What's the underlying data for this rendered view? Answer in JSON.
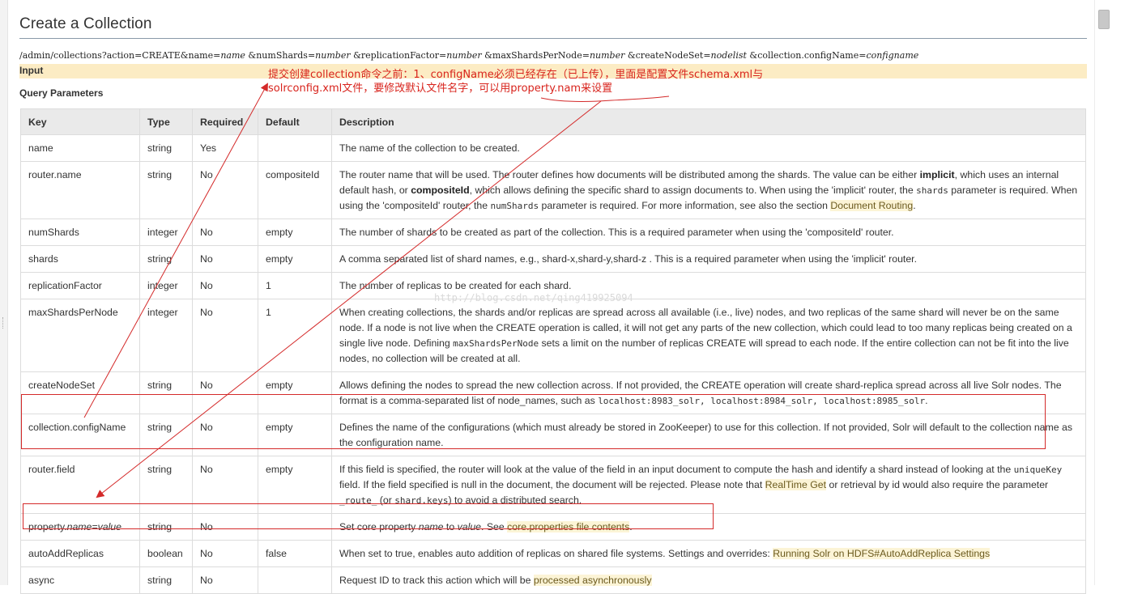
{
  "page": {
    "title": "Create a Collection"
  },
  "endpoint": {
    "prefix": "/admin/collections?action=CREATE&name=",
    "name_param": "name",
    "shards_prefix": " &numShards=",
    "shards_param": "number",
    "rf_prefix": " &replicationFactor=",
    "rf_param": "number",
    "maxspn_prefix": " &maxShardsPerNode=",
    "maxspn_param": "number",
    "cns_prefix": " &createNodeSet=",
    "cns_param": "nodelist",
    "cfg_prefix": " &collection.configName=",
    "cfg_param": "configname"
  },
  "sections": {
    "input": "Input",
    "query_params": "Query Parameters"
  },
  "table": {
    "headers": [
      "Key",
      "Type",
      "Required",
      "Default",
      "Description"
    ],
    "rows": [
      {
        "key": "name",
        "type": "string",
        "required": "Yes",
        "default": "",
        "desc": {
          "text": "The name of the collection to be created."
        }
      },
      {
        "key": "router.name",
        "type": "string",
        "required": "No",
        "default": "compositeId",
        "desc": {
          "p1": "The router name that will be used. The router defines how documents will be distributed among the shards. The value can be either ",
          "b1": "implicit",
          "p2": ", which uses an internal default hash, or ",
          "b2": "compositeId",
          "p3": ", which allows defining the specific shard to assign documents to. When using the 'implicit' router, the ",
          "m1": "shards",
          "p4": " parameter is required. When using the 'compositeId' router, the ",
          "m2": "numShards",
          "p5": " parameter is required. For more information, see also the section ",
          "link": "Document Routing",
          "p6": "."
        }
      },
      {
        "key": "numShards",
        "type": "integer",
        "required": "No",
        "default": "empty",
        "desc": {
          "text": "The number of shards to be created as part of the collection. This is a required parameter when using the 'compositeId' router."
        }
      },
      {
        "key": "shards",
        "type": "string",
        "required": "No",
        "default": "empty",
        "desc": {
          "text": "A comma separated list of shard names, e.g., shard-x,shard-y,shard-z . This is a required parameter when using the 'implicit' router."
        }
      },
      {
        "key": "replicationFactor",
        "type": "integer",
        "required": "No",
        "default": "1",
        "desc": {
          "text": "The number of replicas to be created for each shard."
        }
      },
      {
        "key": "maxShardsPerNode",
        "type": "integer",
        "required": "No",
        "default": "1",
        "desc": {
          "p1": "When creating collections, the shards and/or replicas are spread across all available (i.e., live) nodes, and two replicas of the same shard will never be on the same node. If a node is not live when the CREATE operation is called, it will not get any parts of the new collection, which could lead to too many replicas being created on a single live node. Defining ",
          "m1": "maxShardsPerNode",
          "p2": " sets a limit on the number of replicas CREATE will spread to each node. If the entire collection can not be fit into the live nodes, no collection will be created at all."
        }
      },
      {
        "key": "createNodeSet",
        "type": "string",
        "required": "No",
        "default": "empty",
        "desc": {
          "p1": "Allows defining the nodes to spread the new collection across. If not provided, the CREATE operation will create shard-replica spread across all live Solr nodes. The format is a comma-separated list of node_names, such as ",
          "m1": "localhost:8983_solr, localhost:8984_solr, localhost:8985_solr",
          "p2": "."
        }
      },
      {
        "key": "collection.configName",
        "type": "string",
        "required": "No",
        "default": "empty",
        "desc": {
          "text": "Defines the name of the configurations (which must already be stored in ZooKeeper) to use for this collection. If not provided, Solr will default to the collection name as the configuration name."
        }
      },
      {
        "key": "router.field",
        "type": "string",
        "required": "No",
        "default": "empty",
        "desc": {
          "p1": "If this field is specified, the router will look at the value of the field in an input document to compute the hash and identify a shard instead of looking at the ",
          "m1": "uniqueKey",
          "p2": " field. If the field specified is null in the document, the document will be rejected. Please note that ",
          "link": "RealTime Get",
          "p3": " or retrieval by id would also require the parameter ",
          "m2": "_route_",
          "p4": " (or ",
          "m3": "shard.keys",
          "p5": ") to avoid a distributed search."
        }
      },
      {
        "key_prefix": "property.",
        "key_italic": "name",
        "key_eq": "=",
        "key_italic2": "value",
        "type": "string",
        "required": "No",
        "default": "",
        "desc": {
          "p1": "Set core property ",
          "i1": "name",
          "p2": " to ",
          "i2": "value",
          "p3": ". See ",
          "link": "core.properties file contents",
          "p4": "."
        }
      },
      {
        "key": "autoAddReplicas",
        "type": "boolean",
        "required": "No",
        "default": "false",
        "desc": {
          "p1": "When set to true, enables auto addition of replicas on shared file systems. Settings and overrides: ",
          "link": "Running Solr on HDFS#AutoAddReplica Settings"
        }
      },
      {
        "key": "async",
        "type": "string",
        "required": "No",
        "default": "",
        "desc": {
          "p1": "Request ID to track this action which will be ",
          "link": "processed asynchronously"
        }
      }
    ]
  },
  "annotation": {
    "line1": "提交创建collection命令之前：1、configName必须已经存在（已上传），里面是配置文件schema.xml与",
    "line2": "solrconfig.xml文件，要修改默认文件名字，可以用property.nam来设置"
  },
  "watermark": "http://blog.csdn.net/qing419925094",
  "colors": {
    "annotation": "#d8231c",
    "link_bg": "#fcf4d6",
    "input_bar": "#fcecc4"
  }
}
